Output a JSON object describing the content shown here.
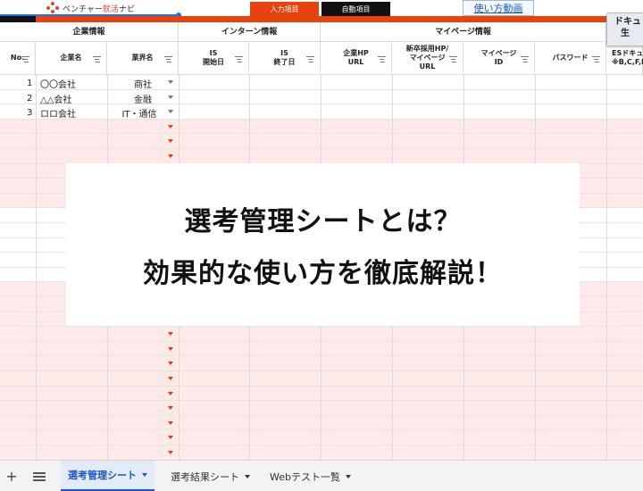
{
  "top": {
    "logo_prefix": "ベンチャー",
    "logo_highlight": "就活",
    "logo_suffix": "ナビ",
    "legend_input": "入力項目",
    "legend_auto": "自動項目",
    "video_link": "使い方動画",
    "doc_button": "ドキュ\n  生"
  },
  "colors": {
    "accent": "#e8420e",
    "row_tint": "#fde9e7",
    "link": "#1a57c8"
  },
  "header": {
    "groups": [
      "企業情報",
      "インターン情報",
      "マイページ情報"
    ],
    "columns": [
      "No.",
      "企業名",
      "業界名",
      "IS\n開始日",
      "IS\n終了日",
      "企業HP\nURL",
      "新卒採用HP/\nマイページ\nURL",
      "マイページ\nID",
      "パスワード",
      "ESドキュ\n※B,C,F,I"
    ]
  },
  "rows": [
    {
      "no": "1",
      "company": "〇〇会社",
      "industry": "商社"
    },
    {
      "no": "2",
      "company": "△△会社",
      "industry": "金融"
    },
    {
      "no": "3",
      "company": "ロロ会社",
      "industry": "IT・通信"
    }
  ],
  "overlay": {
    "line1": "選考管理シートとは？",
    "line2": "効果的な使い方を徹底解説！"
  },
  "tabs": {
    "add_icon": "+",
    "items": [
      {
        "label": "選考管理シート",
        "active": true
      },
      {
        "label": "選考結果シート",
        "active": false
      },
      {
        "label": "Webテスト一覧",
        "active": false
      }
    ]
  }
}
